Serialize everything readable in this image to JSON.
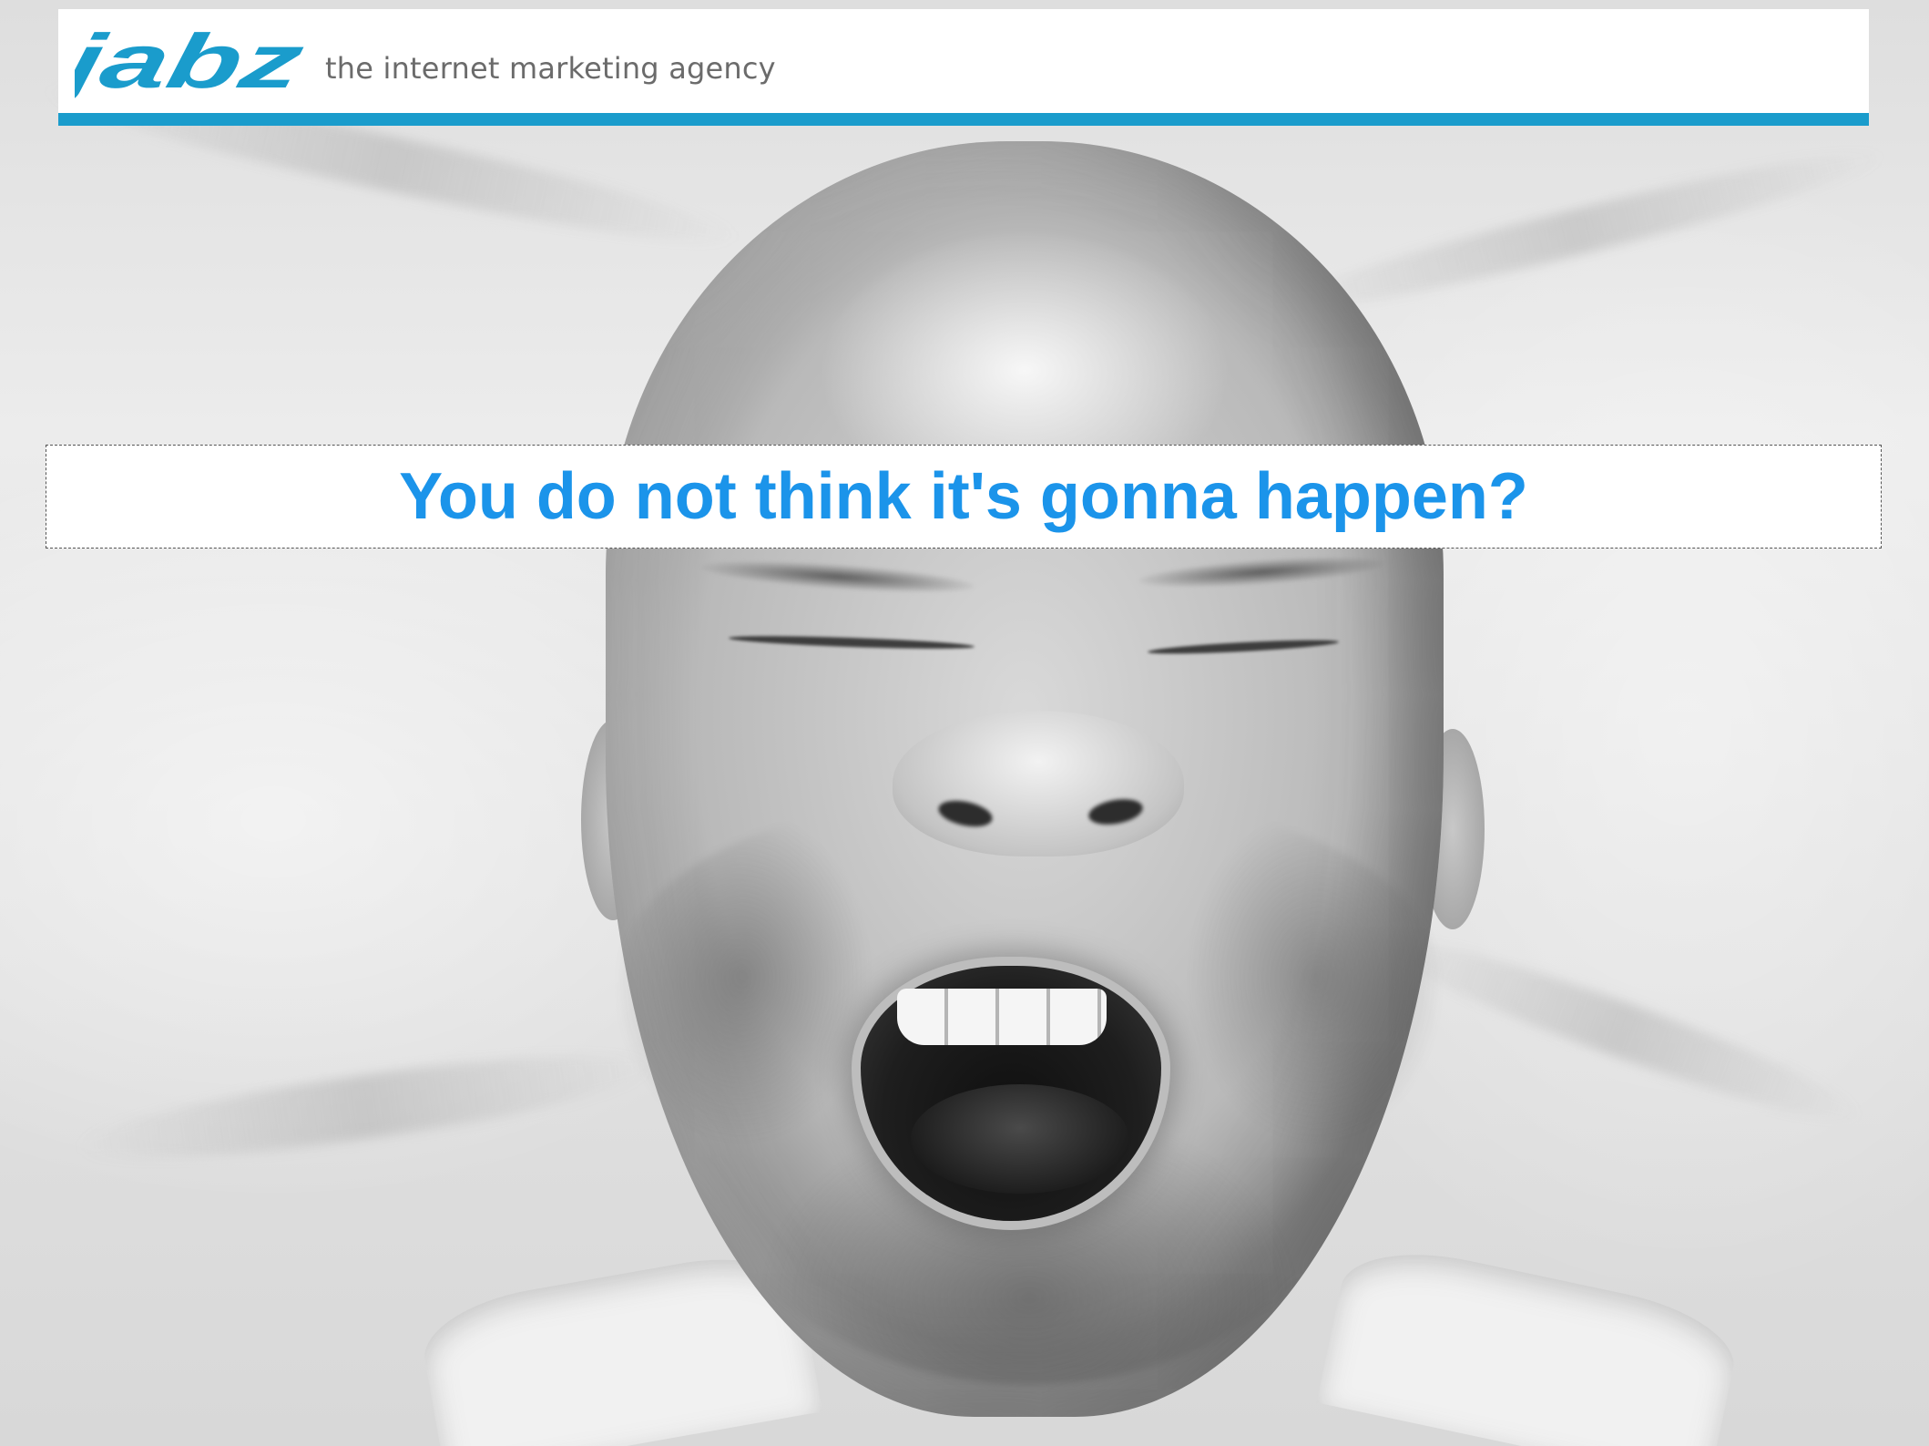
{
  "header": {
    "logo_text": "jabz",
    "tagline": "the internet marketing agency",
    "brand_color": "#1a9ccc"
  },
  "slide": {
    "title": "You do not think it's gonna happen?",
    "title_color": "#1b94ea"
  },
  "background": {
    "style": "black-and-white photograph",
    "icon": "yawning-man-photo"
  }
}
